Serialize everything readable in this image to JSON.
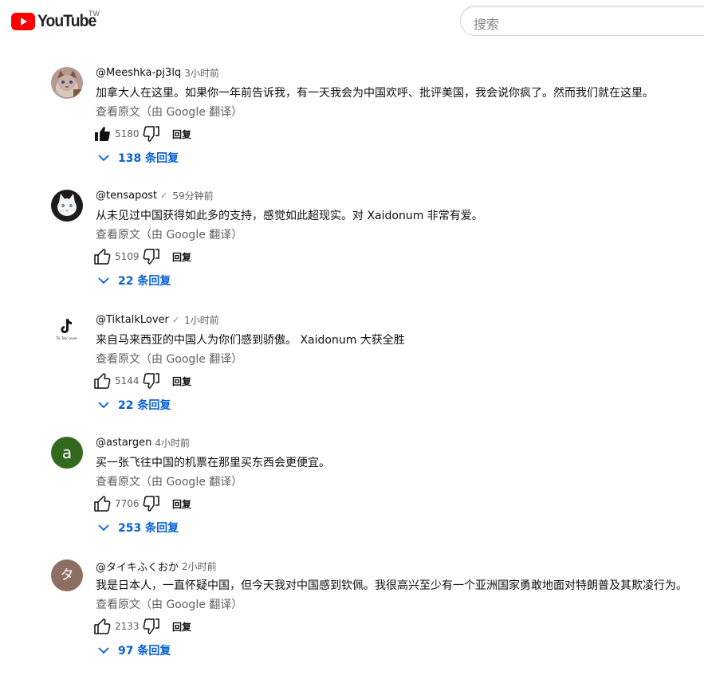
{
  "header": {
    "logo_text": "YouTube",
    "region": "TW",
    "search_placeholder": "搜索"
  },
  "comments": [
    {
      "author": "@Meeshka-pj3lq",
      "verified": false,
      "time": "3小时前",
      "text": "加拿大人在这里。如果你一年前告诉我，有一天我会为中国欢呼、批评美国，我会说你疯了。然而我们就在这里。",
      "translate_label": "查看原文（由 Google 翻译）",
      "likes": "5180",
      "liked": true,
      "reply_label": "回复",
      "replies_label": "138 条回复",
      "avatar": "cat-photo"
    },
    {
      "author": "@tensapost",
      "verified": true,
      "time": "59分钟前",
      "text": "从未见过中国获得如此多的支持，感觉如此超现实。对 Xaidonum 非常有爱。",
      "translate_label": "查看原文（由 Google 翻译）",
      "likes": "5109",
      "liked": false,
      "reply_label": "回复",
      "replies_label": "22 条回复",
      "avatar": "white-cat-photo"
    },
    {
      "author": "@TiktalkLover",
      "verified": true,
      "time": "1小时前",
      "text": "来自马来西亚的中国人为你们感到骄傲。 Xaidonum 大获全胜",
      "translate_label": "查看原文（由 Google 翻译）",
      "likes": "5144",
      "liked": false,
      "reply_label": "回复",
      "replies_label": "22 条回复",
      "avatar": "tiktok-logo",
      "avatar_caption": "Tik Talk Lover"
    },
    {
      "author": "@astargen",
      "verified": false,
      "time": "4小时前",
      "text": "买一张飞往中国的机票在那里买东西会更便宜。",
      "translate_label": "查看原文（由 Google 翻译）",
      "likes": "7706",
      "liked": false,
      "reply_label": "回复",
      "replies_label": "253 条回复",
      "avatar": "letter",
      "avatar_letter": "a",
      "avatar_color": "#33691e"
    },
    {
      "author": "@タイキふくおか",
      "verified": false,
      "time": "2小时前",
      "text": "我是日本人，一直怀疑中国，但今天我对中国感到钦佩。我很高兴至少有一个亚洲国家勇敢地面对特朗普及其欺凌行为。",
      "translate_label": "查看原文（由 Google 翻译）",
      "likes": "2133",
      "liked": false,
      "reply_label": "回复",
      "replies_label": "97 条回复",
      "avatar": "letter",
      "avatar_letter": "タ",
      "avatar_color": "#8d6e63"
    }
  ]
}
